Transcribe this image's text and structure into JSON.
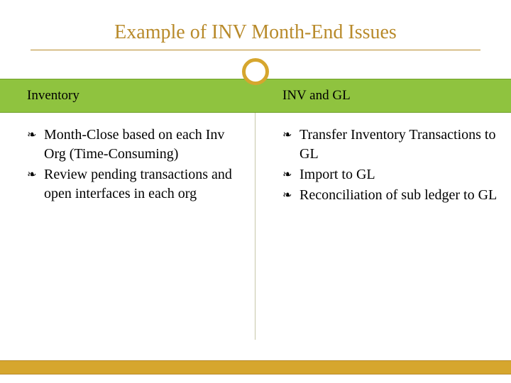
{
  "slide": {
    "title": "Example of INV Month-End Issues",
    "columns": [
      {
        "header": "Inventory",
        "items": [
          "Month-Close based on each Inv Org (Time-Consuming)",
          "Review pending transactions and open interfaces in each org"
        ]
      },
      {
        "header": "INV and GL",
        "items": [
          "Transfer Inventory Transactions to GL",
          "Import to GL",
          "Reconciliation of sub ledger to GL"
        ]
      }
    ],
    "bullet_glyph": "&#x07;"
  }
}
